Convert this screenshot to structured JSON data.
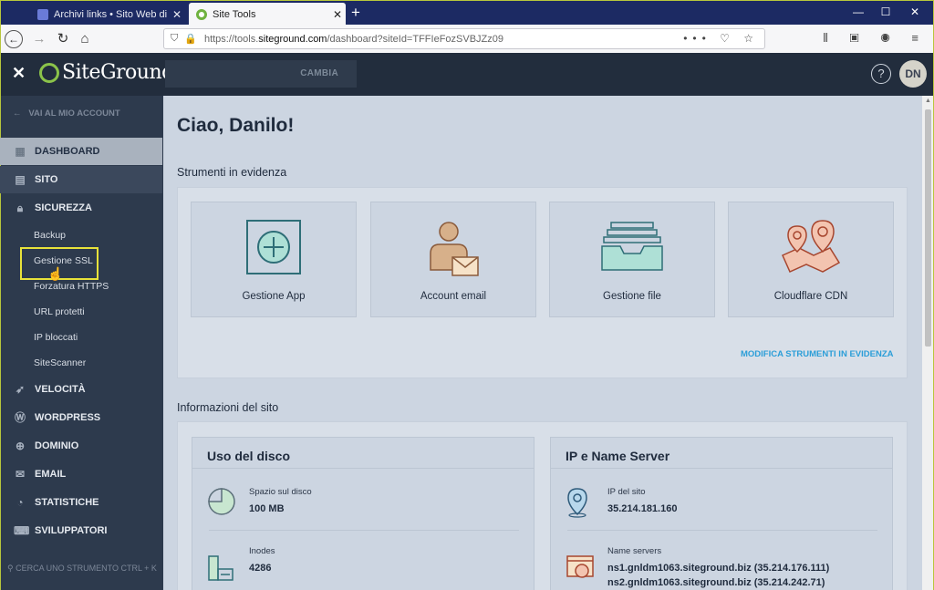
{
  "browser": {
    "tabs": [
      {
        "title": "Archivi links • Sito Web di Dani",
        "active": false
      },
      {
        "title": "Site Tools",
        "active": true
      }
    ],
    "url_prefix": "https://tools.",
    "url_domain": "siteground.com",
    "url_path": "/dashboard?siteId=TFFIeFozSVBJZz09"
  },
  "header": {
    "logo_text": "SiteGround",
    "switch_label": "CAMBIA",
    "help_label": "?",
    "avatar_initials": "DN"
  },
  "sidebar": {
    "back_label": "VAI AL MIO ACCOUNT",
    "items": [
      {
        "label": "DASHBOARD",
        "icon": "dashboard-icon"
      },
      {
        "label": "SITO",
        "icon": "site-icon"
      },
      {
        "label": "SICUREZZA",
        "icon": "lock-icon"
      },
      {
        "label": "VELOCITÀ",
        "icon": "rocket-icon"
      },
      {
        "label": "WORDPRESS",
        "icon": "wordpress-icon"
      },
      {
        "label": "DOMINIO",
        "icon": "globe-icon"
      },
      {
        "label": "EMAIL",
        "icon": "mail-icon"
      },
      {
        "label": "STATISTICHE",
        "icon": "pie-chart-icon"
      },
      {
        "label": "SVILUPPATORI",
        "icon": "code-icon"
      }
    ],
    "security_subitems": [
      "Backup",
      "Gestione SSL",
      "Forzatura HTTPS",
      "URL protetti",
      "IP bloccati",
      "SiteScanner"
    ],
    "search_placeholder": "CERCA UNO STRUMENTO CTRL + K"
  },
  "main": {
    "greeting": "Ciao, Danilo!",
    "featured_title": "Strumenti in evidenza",
    "featured_tools": [
      "Gestione App",
      "Account email",
      "Gestione file",
      "Cloudflare CDN"
    ],
    "edit_featured": "MODIFICA STRUMENTI IN EVIDENZA",
    "site_info_title": "Informazioni del sito",
    "disk": {
      "title": "Uso del disco",
      "space_label": "Spazio sul disco",
      "space_value": "100 MB",
      "inodes_label": "Inodes",
      "inodes_value": "4286"
    },
    "ip": {
      "title": "IP e Name Server",
      "ip_label": "IP del sito",
      "ip_value": "35.214.181.160",
      "ns_label": "Name servers",
      "ns1": "ns1.gnldm1063.siteground.biz (35.214.176.111)",
      "ns2": "ns2.gnldm1063.siteground.biz (35.214.242.71)"
    }
  }
}
